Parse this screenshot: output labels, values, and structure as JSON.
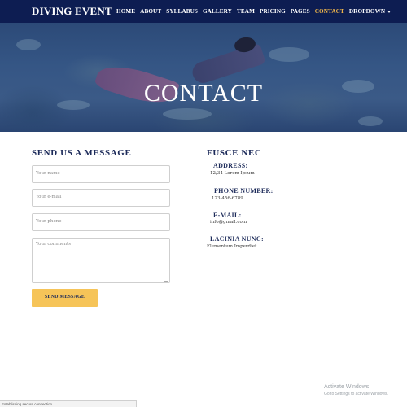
{
  "navbar": {
    "brand": "DIVING EVENT",
    "links": [
      {
        "label": "HOME"
      },
      {
        "label": "ABOUT"
      },
      {
        "label": "SYLLABUS"
      },
      {
        "label": "GALLERY"
      },
      {
        "label": "TEAM"
      },
      {
        "label": "PRICING"
      },
      {
        "label": "PAGES"
      },
      {
        "label": "CONTACT",
        "active": true
      },
      {
        "label": "DROPDOWN"
      }
    ],
    "active_color": "#f3b84a",
    "background": "#0d1d52"
  },
  "hero": {
    "title": "CONTACT"
  },
  "form": {
    "heading": "SEND US A MESSAGE",
    "name_placeholder": "Your name",
    "email_placeholder": "Your e-mail",
    "phone_placeholder": "Your phone",
    "comments_placeholder": "Your comments",
    "submit_label": "SEND MESSAGE",
    "submit_color": "#f6c458"
  },
  "info": {
    "heading": "FUSCE NEC",
    "address_label": "ADDRESS:",
    "address_value": "12/34 Lorem Ipsum",
    "phone_label": "PHONE NUMBER:",
    "phone_value": "123-456-6789",
    "email_label": "E-MAIL:",
    "email_value": "info@gmail.com",
    "lacinia_label": "LACINIA NUNC:",
    "lacinia_value": "Elementum Imperdiet"
  },
  "overlay": {
    "watermark_title": "Activate Windows",
    "watermark_sub": "Go to Settings to activate Windows.",
    "status_text": "Establishing secure connection..."
  }
}
